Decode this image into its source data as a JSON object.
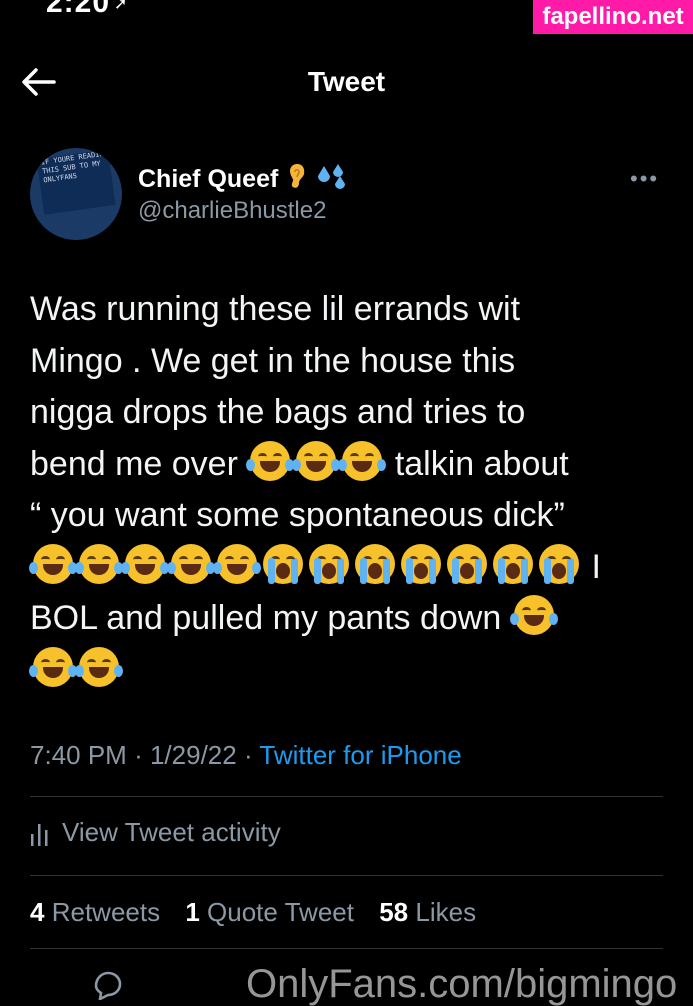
{
  "status_bar": {
    "time": "2:20"
  },
  "watermark_top": "fapellino.net",
  "watermark_bottom": "OnlyFans.com/bigmingo",
  "nav": {
    "title": "Tweet",
    "back_icon": "arrow-left-icon"
  },
  "author": {
    "name": "Chief Queef",
    "handle": "@charlieBhustle2",
    "name_emojis": [
      "ear-emoji",
      "sweat-droplets-emoji"
    ],
    "avatar_text": "IF YOURE READING THIS SUB TO MY ONLYFANS"
  },
  "tweet": {
    "line1": "Was running these lil errands wit",
    "line2": "Mingo . We get in the house this",
    "line3": "nigga drops the bags and tries to",
    "line4_text": "bend me over",
    "line4_after": "talkin about",
    "line5": "“ you want some spontaneous dick”",
    "line6_after": "I",
    "line7_text": "BOL and pulled my pants down",
    "emoji_names": [
      "face-with-tears-of-joy",
      "loudly-crying-face"
    ]
  },
  "meta": {
    "time": "7:40 PM",
    "date": "1/29/22",
    "separator": "·",
    "source": "Twitter for iPhone"
  },
  "activity": {
    "label": "View Tweet activity",
    "icon": "analytics-icon"
  },
  "stats": {
    "retweets_count": "4",
    "retweets_label": "Retweets",
    "quotes_count": "1",
    "quotes_label": "Quote Tweet",
    "likes_count": "58",
    "likes_label": "Likes"
  },
  "colors": {
    "background": "#000000",
    "link": "#1d9bf0",
    "secondary_text": "#8b98a5",
    "watermark_bg": "#ff1aa8"
  }
}
